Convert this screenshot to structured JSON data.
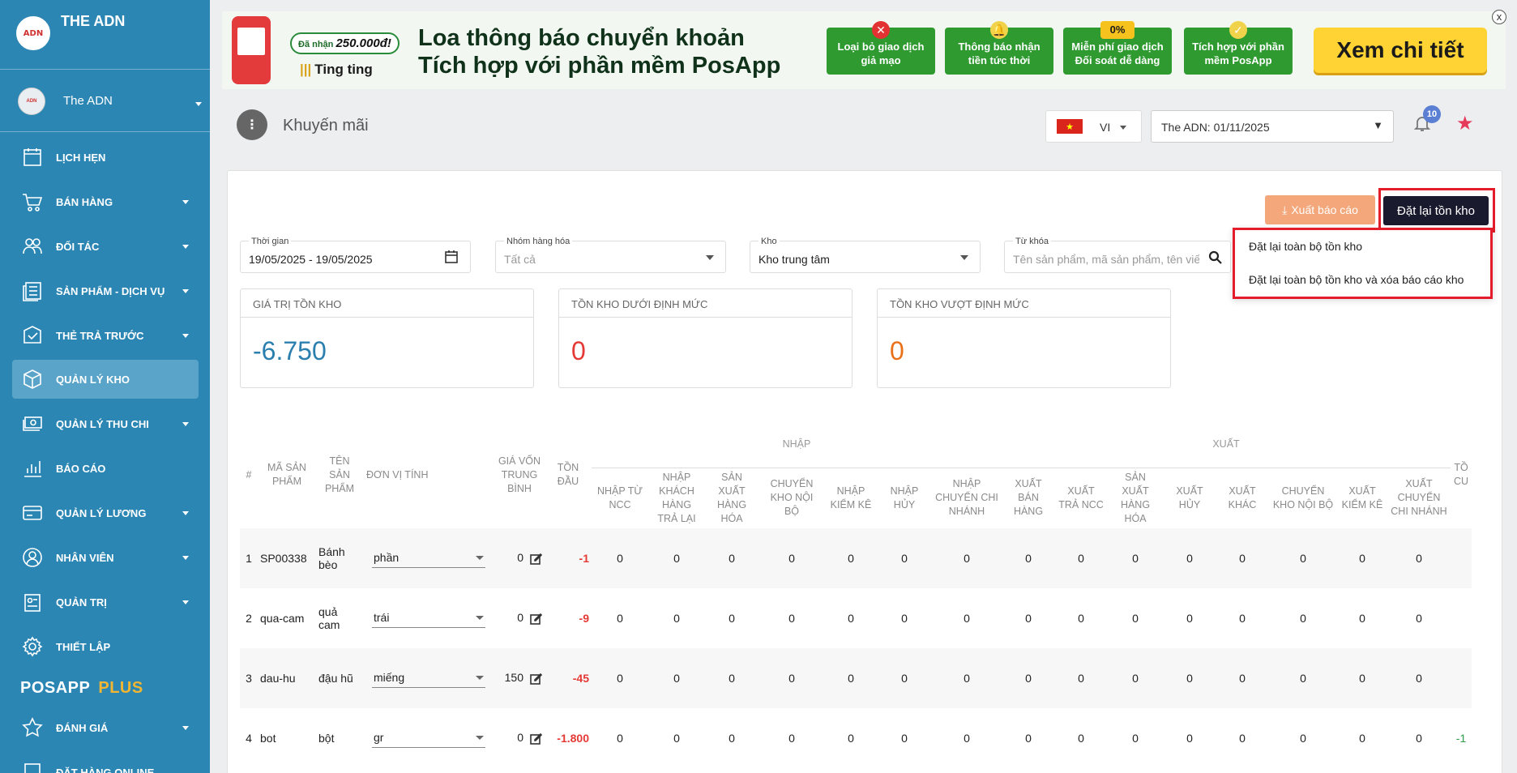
{
  "sidebar": {
    "brand": "THE ADN",
    "logo_text": "ADN",
    "store_name": "The ADN",
    "items": [
      {
        "label": "LỊCH HẸN",
        "icon": "calendar-icon"
      },
      {
        "label": "BÁN HÀNG",
        "icon": "cart-icon"
      },
      {
        "label": "ĐỐI TÁC",
        "icon": "partner-icon"
      },
      {
        "label": "SẢN PHẨM - DỊCH VỤ",
        "icon": "product-icon"
      },
      {
        "label": "THẺ TRẢ TRƯỚC",
        "icon": "prepaid-card-icon"
      },
      {
        "label": "QUẢN LÝ KHO",
        "icon": "box-icon"
      },
      {
        "label": "QUẢN LÝ THU CHI",
        "icon": "money-icon"
      },
      {
        "label": "BÁO CÁO",
        "icon": "bar-chart-icon"
      },
      {
        "label": "QUẢN LÝ LƯƠNG",
        "icon": "salary-card-icon"
      },
      {
        "label": "NHÂN VIÊN",
        "icon": "user-icon"
      },
      {
        "label": "QUẢN TRỊ",
        "icon": "admin-icon"
      },
      {
        "label": "THIẾT LẬP",
        "icon": "gear-icon"
      }
    ],
    "section_posapp": "POSAPP",
    "section_plus": "PLUS",
    "after_items": [
      {
        "label": "ĐÁNH GIÁ",
        "icon": "star-outline-icon"
      },
      {
        "label": "ĐẶT HÀNG ONLINE",
        "icon": "order-icon"
      }
    ]
  },
  "banner": {
    "reward": "Đã nhận",
    "reward_amount": "250.000đ!",
    "ting": "Ting ting",
    "headline_1": "Loa thông báo chuyển khoản",
    "headline_2": "Tích hợp với phần mềm PosApp",
    "boxes": [
      {
        "text": "Loại bỏ giao dịch giả mạo",
        "badge": "✕"
      },
      {
        "text": "Thông báo nhận tiền tức thời",
        "badge": "🔔"
      },
      {
        "text": "Miễn phí giao dịch Đối soát dễ dàng",
        "badge": "0%"
      },
      {
        "text": "Tích hợp với phần mềm PosApp",
        "badge": "✓"
      }
    ],
    "cta": "Xem chi tiết",
    "close": "x"
  },
  "header": {
    "title": "Khuyến mãi",
    "lang_code": "VI",
    "date_select": "The ADN: 01/11/2025",
    "notif_count": "10"
  },
  "actions": {
    "export": "Xuất báo cáo",
    "reset": "Đặt lại tồn kho",
    "menu": [
      "Đặt lại toàn bộ tồn kho",
      "Đặt lại toàn bộ tồn kho và xóa báo cáo kho"
    ]
  },
  "filters": {
    "time_label": "Thời gian",
    "time_value": "19/05/2025 - 19/05/2025",
    "group_label": "Nhóm hàng hóa",
    "group_value": "Tất cả",
    "warehouse_label": "Kho",
    "warehouse_value": "Kho trung tâm",
    "keyword_label": "Từ khóa",
    "keyword_placeholder": "Tên sản phẩm, mã sản phẩm, tên viết tắt"
  },
  "stats": [
    {
      "title": "GIÁ TRỊ TỒN KHO",
      "value": "-6.750",
      "color": "#2b7fae"
    },
    {
      "title": "TỒN KHO DƯỚI ĐỊNH MỨC",
      "value": "0",
      "color": "#e53935"
    },
    {
      "title": "TỒN KHO VƯỢT ĐỊNH MỨC",
      "value": "0",
      "color": "#e8711a"
    }
  ],
  "table": {
    "group_import": "NHẬP",
    "group_export": "XUẤT",
    "headers": [
      "#",
      "MÃ SẢN PHẨM",
      "TÊN SẢN PHẨM",
      "ĐƠN VỊ TÍNH",
      "GIÁ VỐN TRUNG BÌNH",
      "TỒN ĐẦU",
      "NHẬP TỪ NCC",
      "NHẬP KHÁCH HÀNG TRẢ LẠI",
      "SẢN XUẤT HÀNG HÓA",
      "CHUYỂN KHO NỘI BỘ",
      "NHẬP KIỂM KÊ",
      "NHẬP HỦY",
      "NHẬP CHUYỂN CHI NHÁNH",
      "XUẤT BÁN HÀNG",
      "XUẤT TRẢ NCC",
      "SẢN XUẤT HÀNG HÓA",
      "XUẤT HỦY",
      "XUẤT KHÁC",
      "CHUYỂN KHO NỘI BỘ",
      "XUẤT KIỂM KÊ",
      "XUẤT CHUYỂN CHI NHÁNH",
      "TỒ CU"
    ],
    "rows": [
      {
        "no": "1",
        "code": "SP00338",
        "name": "Bánh bèo",
        "unit": "phần",
        "cost": "0",
        "open": "-1",
        "vals": [
          "0",
          "0",
          "0",
          "0",
          "0",
          "0",
          "0",
          "0",
          "0",
          "0",
          "0",
          "0",
          "0",
          "0",
          "0"
        ],
        "tail": ""
      },
      {
        "no": "2",
        "code": "qua-cam",
        "name": "quả cam",
        "unit": "trái",
        "cost": "0",
        "open": "-9",
        "vals": [
          "0",
          "0",
          "0",
          "0",
          "0",
          "0",
          "0",
          "0",
          "0",
          "0",
          "0",
          "0",
          "0",
          "0",
          "0"
        ],
        "tail": ""
      },
      {
        "no": "3",
        "code": "dau-hu",
        "name": "đậu hũ",
        "unit": "miếng",
        "cost": "150",
        "open": "-45",
        "vals": [
          "0",
          "0",
          "0",
          "0",
          "0",
          "0",
          "0",
          "0",
          "0",
          "0",
          "0",
          "0",
          "0",
          "0",
          "0"
        ],
        "tail": ""
      },
      {
        "no": "4",
        "code": "bot",
        "name": "bột",
        "unit": "gr",
        "cost": "0",
        "open": "-1.800",
        "vals": [
          "0",
          "0",
          "0",
          "0",
          "0",
          "0",
          "0",
          "0",
          "0",
          "0",
          "0",
          "0",
          "0",
          "0",
          "0"
        ],
        "tail": "-1"
      }
    ]
  }
}
